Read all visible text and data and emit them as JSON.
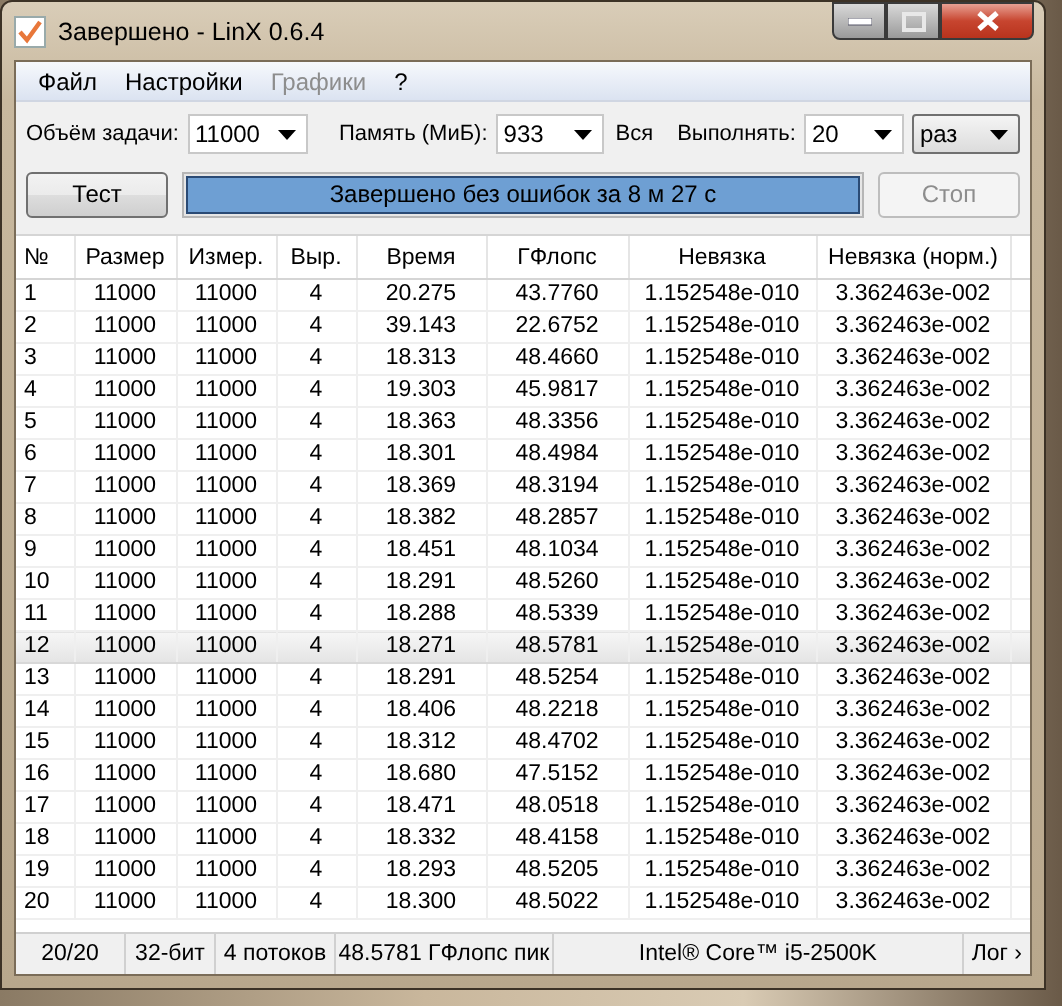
{
  "window": {
    "title": "Завершено - LinX 0.6.4"
  },
  "menu": [
    {
      "label": "Файл",
      "disabled": false
    },
    {
      "label": "Настройки",
      "disabled": false
    },
    {
      "label": "Графики",
      "disabled": true
    },
    {
      "label": "?",
      "disabled": false
    }
  ],
  "options": [
    {
      "kind": "label",
      "text": "Объём задачи:"
    },
    {
      "kind": "combo",
      "value": "11000"
    },
    {
      "kind": "label",
      "text": "Память (МиБ):"
    },
    {
      "kind": "combo",
      "value": "933"
    },
    {
      "kind": "label",
      "text": "Вся"
    },
    {
      "kind": "label",
      "text": "Выполнять:"
    },
    {
      "kind": "combo",
      "value": "20"
    },
    {
      "kind": "dropdown",
      "value": "раз"
    }
  ],
  "test_button": {
    "label": "Тест",
    "disabled": false
  },
  "progress": {
    "level": 1,
    "text": "Завершено без ошибок за 8 м 27 с"
  },
  "stop_button": {
    "label": "Стоп",
    "disabled": true
  },
  "table": {
    "columns": [
      "№",
      "Размер",
      "Измер.",
      "Выр.",
      "Время",
      "ГФлопс",
      "Невязка",
      "Невязка (норм.)"
    ],
    "rows": [
      {
        "selected": false,
        "cells": [
          "1",
          "11000",
          "11000",
          "4",
          "20.275",
          "43.7760",
          "1.152548e-010",
          "3.362463e-002"
        ]
      },
      {
        "selected": false,
        "cells": [
          "2",
          "11000",
          "11000",
          "4",
          "39.143",
          "22.6752",
          "1.152548e-010",
          "3.362463e-002"
        ]
      },
      {
        "selected": false,
        "cells": [
          "3",
          "11000",
          "11000",
          "4",
          "18.313",
          "48.4660",
          "1.152548e-010",
          "3.362463e-002"
        ]
      },
      {
        "selected": false,
        "cells": [
          "4",
          "11000",
          "11000",
          "4",
          "19.303",
          "45.9817",
          "1.152548e-010",
          "3.362463e-002"
        ]
      },
      {
        "selected": false,
        "cells": [
          "5",
          "11000",
          "11000",
          "4",
          "18.363",
          "48.3356",
          "1.152548e-010",
          "3.362463e-002"
        ]
      },
      {
        "selected": false,
        "cells": [
          "6",
          "11000",
          "11000",
          "4",
          "18.301",
          "48.4984",
          "1.152548e-010",
          "3.362463e-002"
        ]
      },
      {
        "selected": false,
        "cells": [
          "7",
          "11000",
          "11000",
          "4",
          "18.369",
          "48.3194",
          "1.152548e-010",
          "3.362463e-002"
        ]
      },
      {
        "selected": false,
        "cells": [
          "8",
          "11000",
          "11000",
          "4",
          "18.382",
          "48.2857",
          "1.152548e-010",
          "3.362463e-002"
        ]
      },
      {
        "selected": false,
        "cells": [
          "9",
          "11000",
          "11000",
          "4",
          "18.451",
          "48.1034",
          "1.152548e-010",
          "3.362463e-002"
        ]
      },
      {
        "selected": false,
        "cells": [
          "10",
          "11000",
          "11000",
          "4",
          "18.291",
          "48.5260",
          "1.152548e-010",
          "3.362463e-002"
        ]
      },
      {
        "selected": false,
        "cells": [
          "11",
          "11000",
          "11000",
          "4",
          "18.288",
          "48.5339",
          "1.152548e-010",
          "3.362463e-002"
        ]
      },
      {
        "selected": true,
        "cells": [
          "12",
          "11000",
          "11000",
          "4",
          "18.271",
          "48.5781",
          "1.152548e-010",
          "3.362463e-002"
        ]
      },
      {
        "selected": false,
        "cells": [
          "13",
          "11000",
          "11000",
          "4",
          "18.291",
          "48.5254",
          "1.152548e-010",
          "3.362463e-002"
        ]
      },
      {
        "selected": false,
        "cells": [
          "14",
          "11000",
          "11000",
          "4",
          "18.406",
          "48.2218",
          "1.152548e-010",
          "3.362463e-002"
        ]
      },
      {
        "selected": false,
        "cells": [
          "15",
          "11000",
          "11000",
          "4",
          "18.312",
          "48.4702",
          "1.152548e-010",
          "3.362463e-002"
        ]
      },
      {
        "selected": false,
        "cells": [
          "16",
          "11000",
          "11000",
          "4",
          "18.680",
          "47.5152",
          "1.152548e-010",
          "3.362463e-002"
        ]
      },
      {
        "selected": false,
        "cells": [
          "17",
          "11000",
          "11000",
          "4",
          "18.471",
          "48.0518",
          "1.152548e-010",
          "3.362463e-002"
        ]
      },
      {
        "selected": false,
        "cells": [
          "18",
          "11000",
          "11000",
          "4",
          "18.332",
          "48.4158",
          "1.152548e-010",
          "3.362463e-002"
        ]
      },
      {
        "selected": false,
        "cells": [
          "19",
          "11000",
          "11000",
          "4",
          "18.293",
          "48.5205",
          "1.152548e-010",
          "3.362463e-002"
        ]
      },
      {
        "selected": false,
        "cells": [
          "20",
          "11000",
          "11000",
          "4",
          "18.300",
          "48.5022",
          "1.152548e-010",
          "3.362463e-002"
        ]
      }
    ]
  },
  "status_bar": [
    "20/20",
    "32-бит",
    "4 потоков",
    "48.5781 ГФлопс пик",
    "Intel® Core™ i5-2500K",
    "Лог ›"
  ]
}
